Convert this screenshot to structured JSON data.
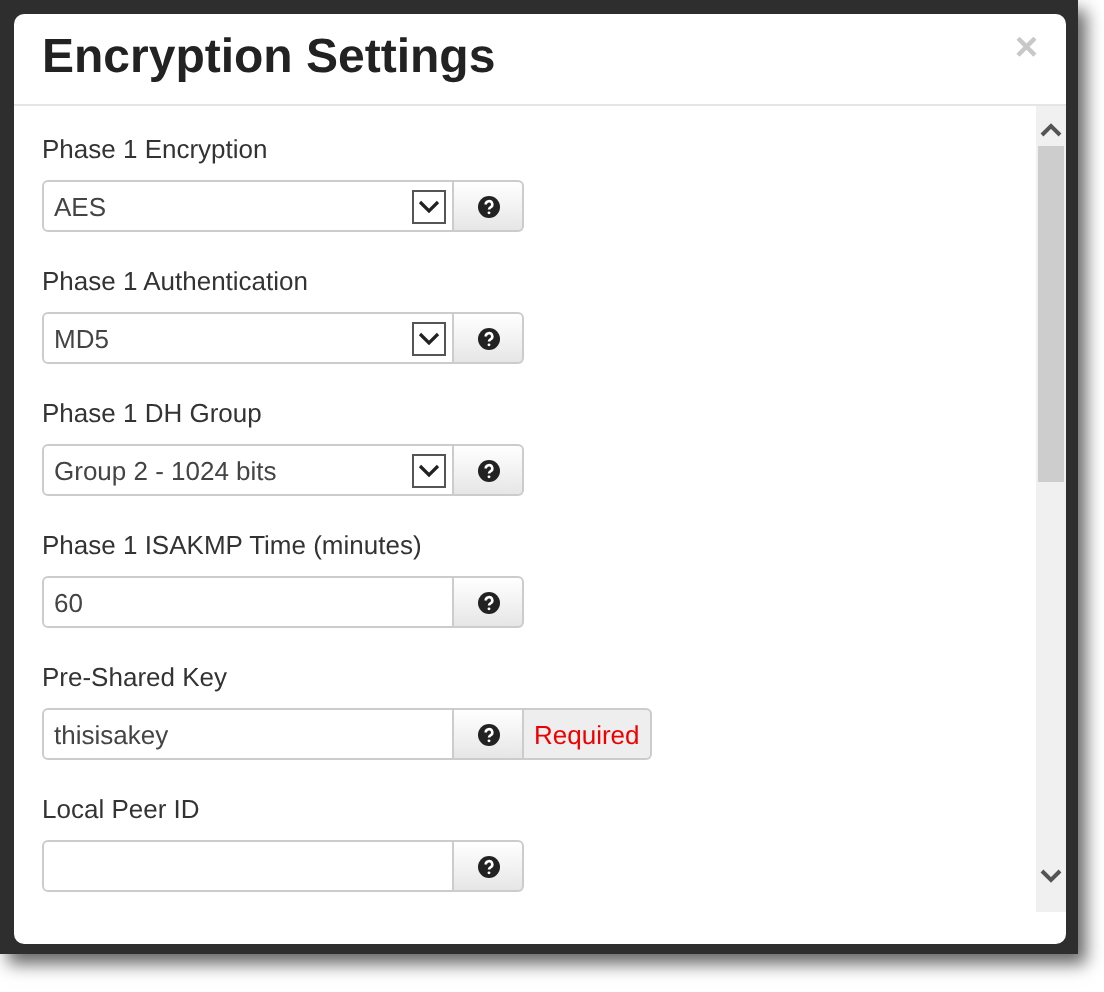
{
  "dialog": {
    "title": "Encryption Settings",
    "close": "×"
  },
  "fields": [
    {
      "kind": "select",
      "label": "Phase 1 Encryption",
      "value": "AES"
    },
    {
      "kind": "select",
      "label": "Phase 1 Authentication",
      "value": "MD5"
    },
    {
      "kind": "select",
      "label": "Phase 1 DH Group",
      "value": "Group 2 - 1024 bits"
    },
    {
      "kind": "input",
      "label": "Phase 1 ISAKMP Time (minutes)",
      "value": "60"
    },
    {
      "kind": "input",
      "label": "Pre-Shared Key",
      "value": "thisisakey",
      "addon": "Required"
    },
    {
      "kind": "input",
      "label": "Local Peer ID"
    }
  ]
}
